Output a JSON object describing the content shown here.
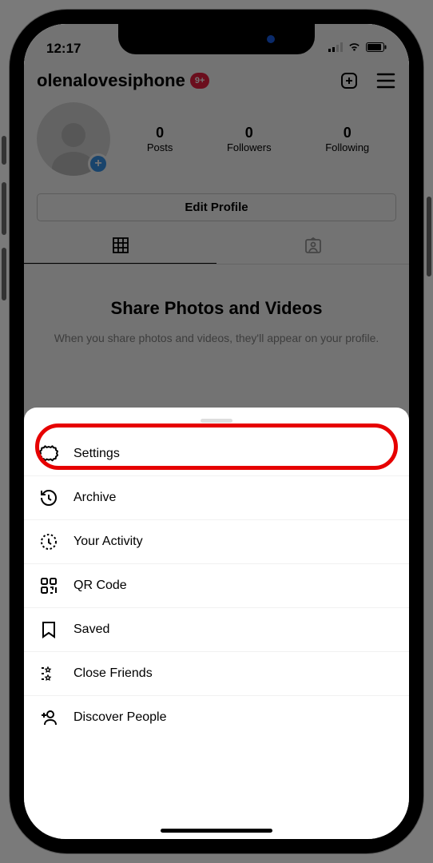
{
  "statusbar": {
    "time": "12:17"
  },
  "header": {
    "username": "olenalovesiphone",
    "badge": "9+"
  },
  "stats": {
    "posts": {
      "count": "0",
      "label": "Posts"
    },
    "followers": {
      "count": "0",
      "label": "Followers"
    },
    "following": {
      "count": "0",
      "label": "Following"
    }
  },
  "edit_profile": "Edit Profile",
  "empty": {
    "title": "Share Photos and Videos",
    "subtitle": "When you share photos and videos, they'll appear on your profile."
  },
  "menu": {
    "settings": "Settings",
    "archive": "Archive",
    "activity": "Your Activity",
    "qr": "QR Code",
    "saved": "Saved",
    "close_friends": "Close Friends",
    "discover": "Discover People"
  }
}
